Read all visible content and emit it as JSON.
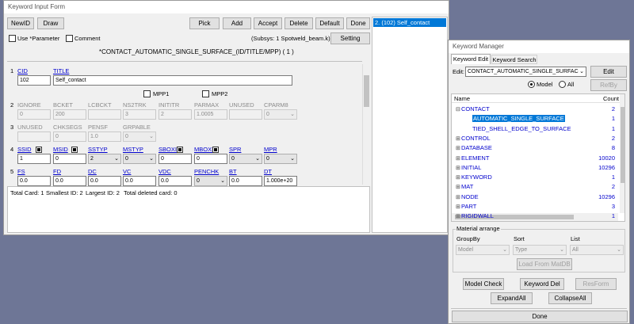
{
  "keyword_form": {
    "title": "Keyword Input Form",
    "buttons": {
      "newid": "NewID",
      "draw": "Draw",
      "pick": "Pick",
      "add": "Add",
      "accept": "Accept",
      "delete": "Delete",
      "default": "Default",
      "done": "Done",
      "setting": "Setting"
    },
    "use_parameter": "Use *Parameter",
    "comment": "Comment",
    "subsys": "(Subsys: 1 Spotweld_beam.k)",
    "keyword_title": "*CONTACT_AUTOMATIC_SINGLE_SURFACE_(ID/TITLE/MPP)   ( 1 )",
    "row1": {
      "num": "1",
      "cid_label": "CID",
      "title_label": "TITLE",
      "cid_value": "102",
      "title_value": "Self_contact",
      "mpp1": "MPP1",
      "mpp2": "MPP2"
    },
    "row2": {
      "num": "2",
      "labels": [
        "IGNORE",
        "BCKET",
        "LCBCKT",
        "NS2TRK",
        "INITITR",
        "PARMAX",
        "UNUSED",
        "CPARM8"
      ],
      "values": [
        "0",
        "200",
        "",
        "3",
        "2",
        "1.0005",
        "",
        "0"
      ]
    },
    "row3": {
      "num": "3",
      "labels": [
        "UNUSED",
        "CHKSEGS",
        "PENSF",
        "GRPABLE"
      ],
      "values": [
        "",
        "0",
        "1.0",
        "0"
      ]
    },
    "row4": {
      "num": "4",
      "labels": [
        "SSID",
        "MSID",
        "SSTYP",
        "MSTYP",
        "SBOXID",
        "MBOXID",
        "SPR",
        "MPR"
      ],
      "values": [
        "1",
        "0",
        "2",
        "0",
        "0",
        "0",
        "0",
        "0"
      ]
    },
    "row5": {
      "num": "5",
      "labels": [
        "FS",
        "FD",
        "DC",
        "VC",
        "VDC",
        "PENCHK",
        "BT",
        "DT"
      ],
      "values": [
        "0.0",
        "0.0",
        "0.0",
        "0.0",
        "0.0",
        "0",
        "0.0",
        "1.000e+20"
      ]
    },
    "status": {
      "total_card": "Total Card: 1",
      "smallest_id": "Smallest ID: 2",
      "largest_id": "Largest ID: 2",
      "deleted": "Total deleted card:  0"
    },
    "id_list": [
      "2.  (102) Self_contact"
    ]
  },
  "keyword_manager": {
    "title": "Keyword Manager",
    "tabs": [
      "Keyword Edit",
      "Keyword Search"
    ],
    "edit_label": "Edit:",
    "edit_value": "CONTACT_AUTOMATIC_SINGLE_SURFAC",
    "edit_button": "Edit",
    "model_label": "Model",
    "all_label": "All",
    "refby_button": "RefBy",
    "columns": {
      "name": "Name",
      "count": "Count"
    },
    "tree": [
      {
        "name": "CONTACT",
        "count": "2",
        "exp": "⊟"
      },
      {
        "name": "AUTOMATIC_SINGLE_SURFACE",
        "count": "1",
        "exp": ""
      },
      {
        "name": "TIED_SHELL_EDGE_TO_SURFACE",
        "count": "1",
        "exp": ""
      },
      {
        "name": "CONTROL",
        "count": "2",
        "exp": "⊞"
      },
      {
        "name": "DATABASE",
        "count": "8",
        "exp": "⊞"
      },
      {
        "name": "ELEMENT",
        "count": "10020",
        "exp": "⊞"
      },
      {
        "name": "INITIAL",
        "count": "10296",
        "exp": "⊞"
      },
      {
        "name": "KEYWORD",
        "count": "1",
        "exp": "⊞"
      },
      {
        "name": "MAT",
        "count": "2",
        "exp": "⊞"
      },
      {
        "name": "NODE",
        "count": "10296",
        "exp": "⊞"
      },
      {
        "name": "PART",
        "count": "3",
        "exp": "⊞"
      },
      {
        "name": "RIGIDWALL",
        "count": "1",
        "exp": "⊞"
      }
    ],
    "material_arrange": "Material arrange",
    "groupby_label": "GroupBy",
    "sort_label": "Sort",
    "list_label": "List",
    "groupby_value": "Model",
    "sort_value": "Type",
    "list_value": "All",
    "load_matdb": "Load From MatDB",
    "model_check": "Model Check",
    "keyword_del": "Keyword Del",
    "resform": "ResForm",
    "expand_all": "ExpandAll",
    "collapse_all": "CollapseAll",
    "done": "Done"
  }
}
